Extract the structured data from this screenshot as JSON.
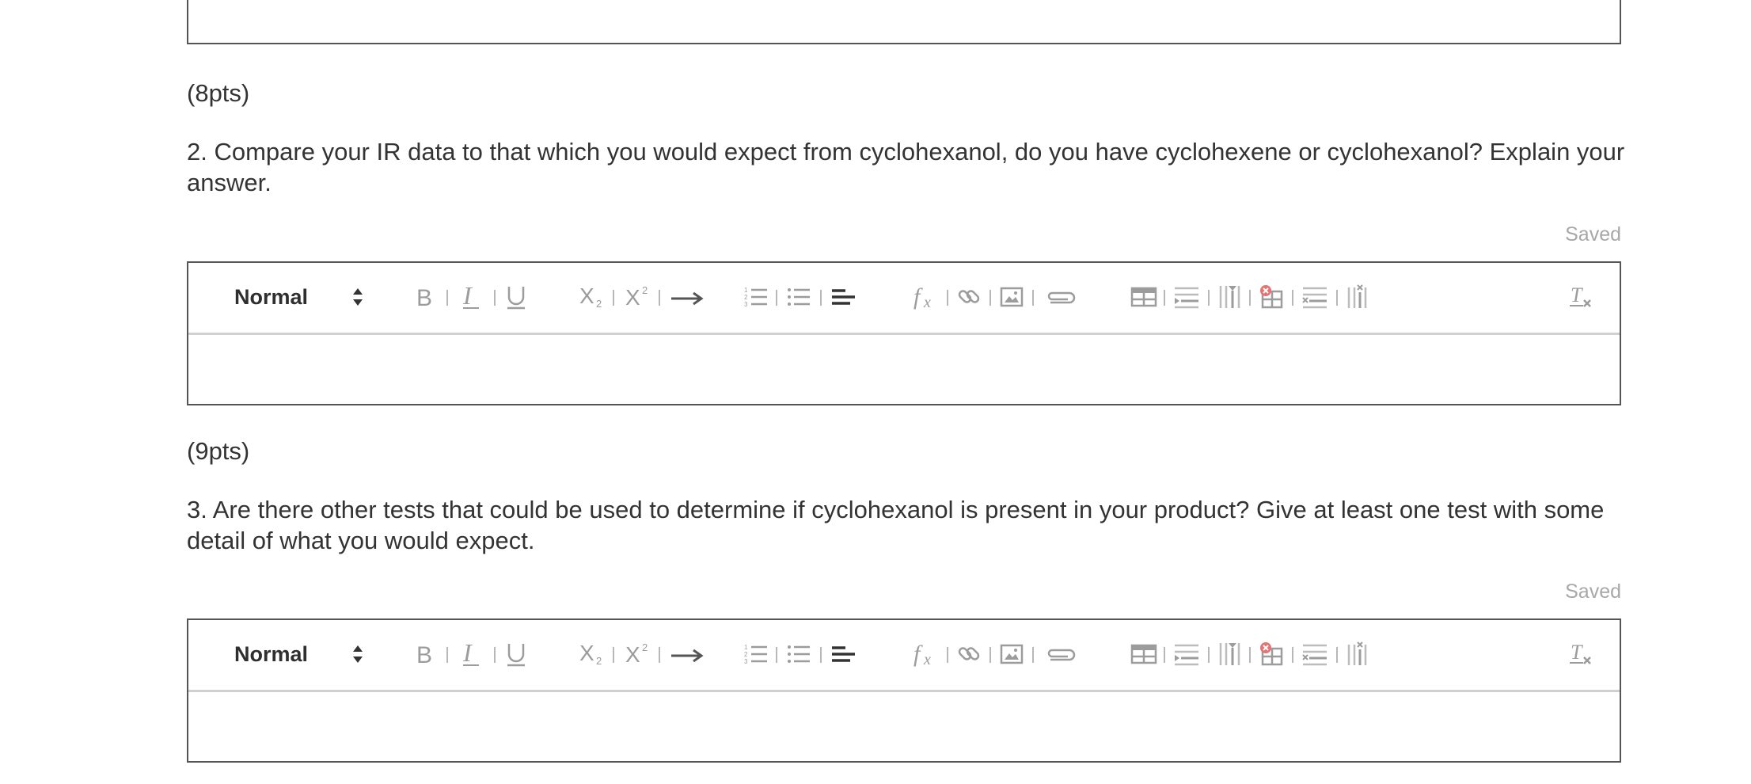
{
  "question2": {
    "points": "(8pts)",
    "text": "2. Compare your IR data to that which you would expect from cyclohexanol, do you have cyclohexene or cyclohexanol? Explain your answer.",
    "status": "Saved"
  },
  "question3": {
    "points": "(9pts)",
    "text": "3. Are there other tests that could be used to determine if cyclohexanol is present in your product? Give at least one test with some detail of what you would expect.",
    "status": "Saved"
  },
  "editor": {
    "format_value": "Normal",
    "toolbar_icons": [
      "bold-icon",
      "italic-icon",
      "underline-icon",
      "subscript-icon",
      "superscript-icon",
      "arrow-icon",
      "ordered-list-icon",
      "bullet-list-icon",
      "align-icon",
      "formula-icon",
      "link-icon",
      "image-icon",
      "attachment-icon",
      "table-icon",
      "insert-row-icon",
      "insert-column-icon",
      "delete-table-icon",
      "delete-row-icon",
      "delete-column-icon",
      "clear-format-icon"
    ]
  },
  "colors": {
    "border": "#555555",
    "text": "#333333",
    "icon": "#9c9c9c",
    "saved": "#a8a8a8"
  }
}
